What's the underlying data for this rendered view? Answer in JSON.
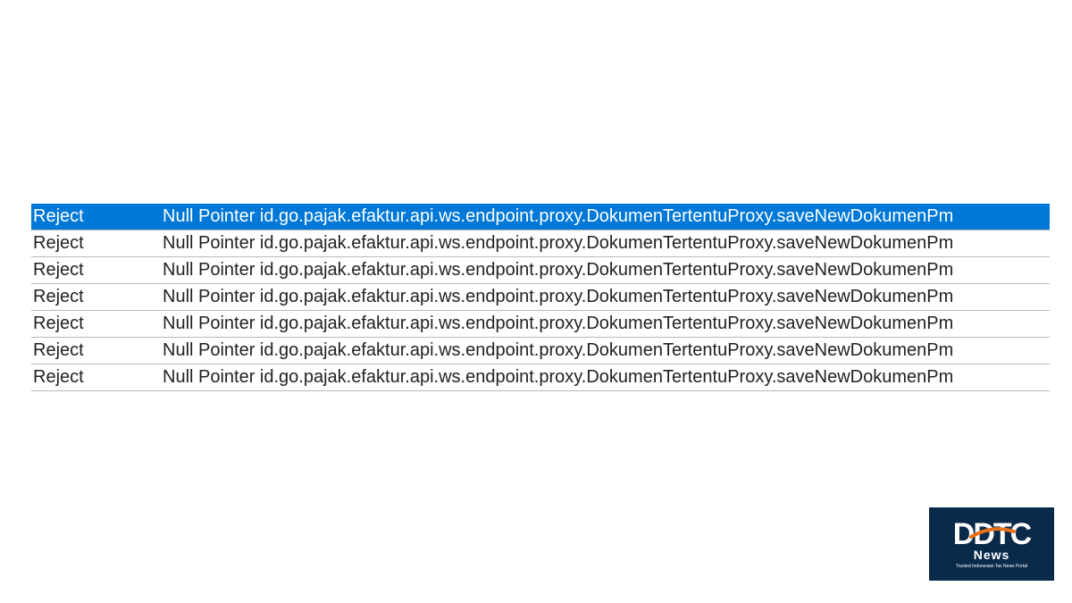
{
  "table": {
    "rows": [
      {
        "status": "Reject",
        "message": "Null Pointer id.go.pajak.efaktur.api.ws.endpoint.proxy.DokumenTertentuProxy.saveNewDokumenPm",
        "selected": true
      },
      {
        "status": "Reject",
        "message": "Null Pointer id.go.pajak.efaktur.api.ws.endpoint.proxy.DokumenTertentuProxy.saveNewDokumenPm",
        "selected": false
      },
      {
        "status": "Reject",
        "message": "Null Pointer id.go.pajak.efaktur.api.ws.endpoint.proxy.DokumenTertentuProxy.saveNewDokumenPm",
        "selected": false
      },
      {
        "status": "Reject",
        "message": "Null Pointer id.go.pajak.efaktur.api.ws.endpoint.proxy.DokumenTertentuProxy.saveNewDokumenPm",
        "selected": false
      },
      {
        "status": "Reject",
        "message": "Null Pointer id.go.pajak.efaktur.api.ws.endpoint.proxy.DokumenTertentuProxy.saveNewDokumenPm",
        "selected": false
      },
      {
        "status": "Reject",
        "message": "Null Pointer id.go.pajak.efaktur.api.ws.endpoint.proxy.DokumenTertentuProxy.saveNewDokumenPm",
        "selected": false
      },
      {
        "status": "Reject",
        "message": "Null Pointer id.go.pajak.efaktur.api.ws.endpoint.proxy.DokumenTertentuProxy.saveNewDokumenPm",
        "selected": false
      }
    ]
  },
  "logo": {
    "brand": "DDTC",
    "sub": "News",
    "tagline": "Trusted Indonesian Tax News Portal"
  }
}
